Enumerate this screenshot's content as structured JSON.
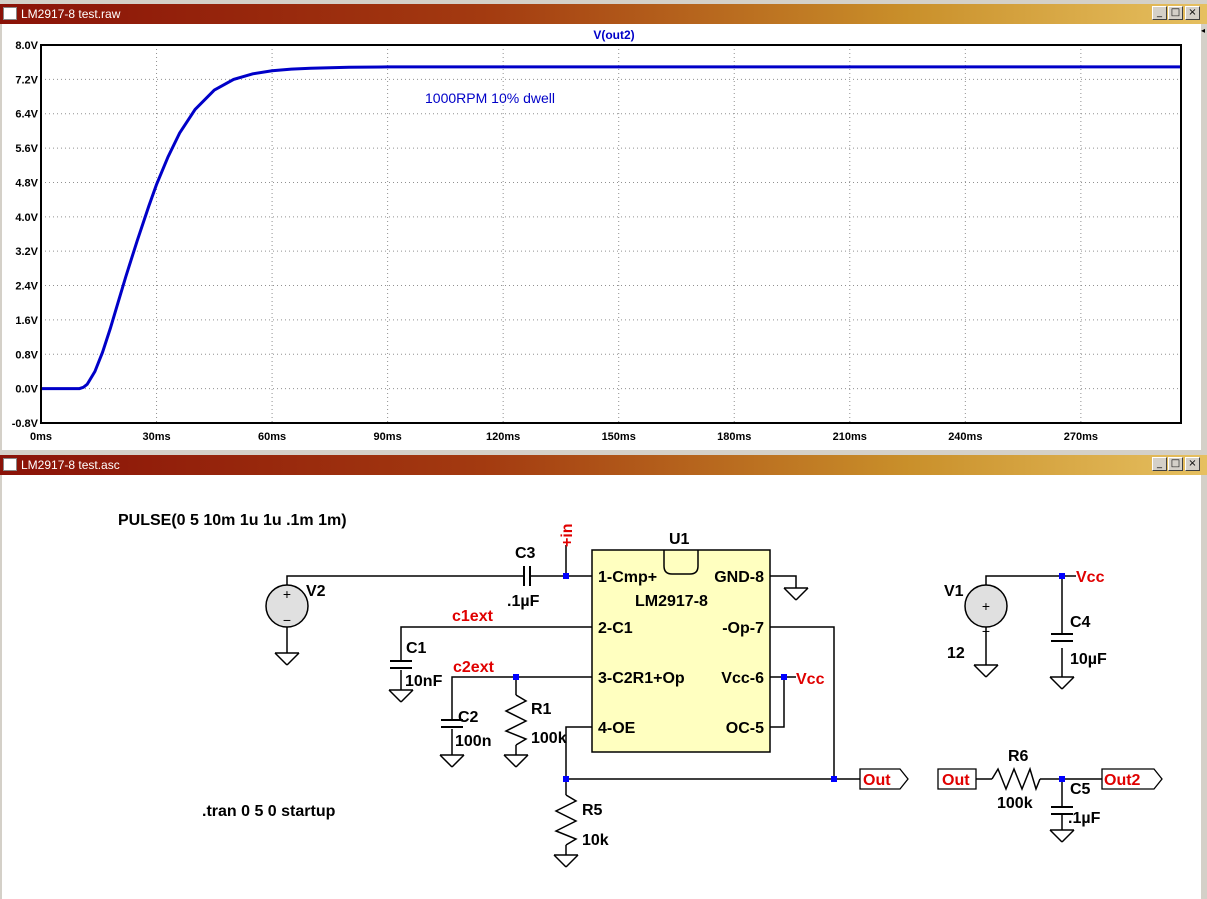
{
  "waveform_window": {
    "title": "LM2917-8 test.raw",
    "trace_name": "V(out2)",
    "annotation": "1000RPM 10% dwell",
    "trace_color": "#0000c8",
    "controls": {
      "minimize": "_",
      "maximize": "□",
      "close": "×"
    }
  },
  "schematic_window": {
    "title": "LM2917-8 test.asc",
    "controls": {
      "minimize": "_",
      "maximize": "□",
      "close": "×"
    },
    "directives": {
      "pulse": "PULSE(0 5 10m 1u 1u .1m 1m)",
      "tran": ".tran 0 5 0 startup"
    },
    "components": {
      "V2": {
        "name": "V2"
      },
      "V1": {
        "name": "V1",
        "value": "12"
      },
      "C1": {
        "name": "C1",
        "value": "10nF"
      },
      "C2": {
        "name": "C2",
        "value": "100n"
      },
      "C3": {
        "name": "C3",
        "value": ".1µF"
      },
      "C4": {
        "name": "C4",
        "value": "10µF"
      },
      "C5": {
        "name": "C5",
        "value": ".1µF"
      },
      "R1": {
        "name": "R1",
        "value": "100k"
      },
      "R5": {
        "name": "R5",
        "value": "10k"
      },
      "R6": {
        "name": "R6",
        "value": "100k"
      },
      "U1": {
        "name": "U1",
        "part": "LM2917-8",
        "pins": {
          "p1": "1-Cmp+",
          "p2": "2-C1",
          "p3": "3-C2R1+Op",
          "p4": "4-OE",
          "p5": "OC-5",
          "p6": "Vcc-6",
          "p7": "-Op-7",
          "p8": "GND-8"
        }
      }
    },
    "net_labels": {
      "in": "+in",
      "c1ext": "c1ext",
      "c2ext": "c2ext",
      "vcc_u1": "Vcc",
      "vcc_v1": "Vcc",
      "out_port": "Out",
      "out_in_port": "Out",
      "out2_port": "Out2"
    },
    "net_label_color": "#e00000"
  },
  "chart_data": {
    "type": "line",
    "title": "V(out2)",
    "xlabel": "",
    "ylabel": "",
    "x_ticks": [
      "0ms",
      "30ms",
      "60ms",
      "90ms",
      "120ms",
      "150ms",
      "180ms",
      "210ms",
      "240ms",
      "270ms"
    ],
    "y_ticks": [
      "-0.8V",
      "0.0V",
      "0.8V",
      "1.6V",
      "2.4V",
      "3.2V",
      "4.0V",
      "4.8V",
      "5.6V",
      "6.4V",
      "7.2V",
      "8.0V"
    ],
    "xlim": [
      0,
      296
    ],
    "ylim": [
      -0.8,
      8.0
    ],
    "grid": true,
    "series": [
      {
        "name": "V(out2)",
        "x": [
          0,
          10,
          11,
          12,
          14,
          16,
          18,
          20,
          22,
          25,
          28,
          30,
          33,
          36,
          40,
          45,
          50,
          55,
          60,
          65,
          70,
          80,
          90,
          100,
          120,
          150,
          200,
          250,
          296
        ],
        "values": [
          0,
          0,
          0.03,
          0.1,
          0.4,
          0.85,
          1.4,
          2.0,
          2.6,
          3.45,
          4.25,
          4.75,
          5.4,
          5.95,
          6.5,
          6.95,
          7.2,
          7.33,
          7.4,
          7.44,
          7.46,
          7.48,
          7.49,
          7.49,
          7.49,
          7.49,
          7.49,
          7.49,
          7.49
        ]
      }
    ]
  }
}
